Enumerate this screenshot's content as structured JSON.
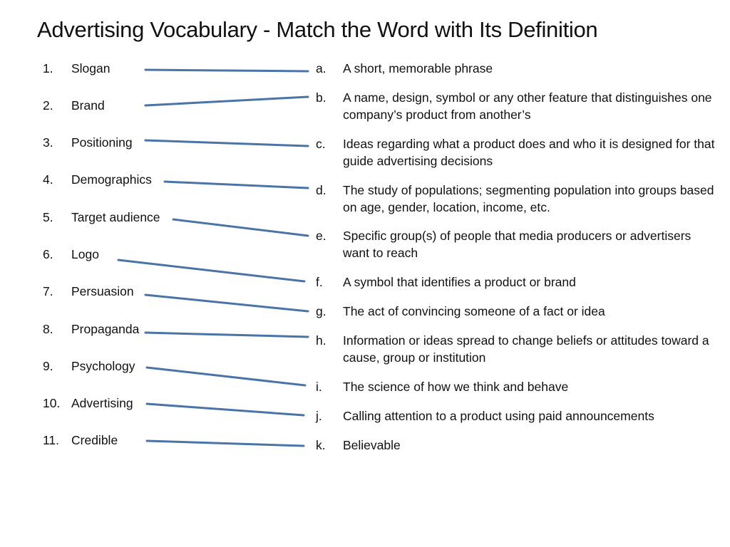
{
  "title": "Advertising Vocabulary - Match the Word with Its Definition",
  "line_color": "#4a74a8",
  "terms": [
    {
      "num": "1.",
      "word": "Slogan"
    },
    {
      "num": "2.",
      "word": "Brand"
    },
    {
      "num": "3.",
      "word": "Positioning"
    },
    {
      "num": "4.",
      "word": "Demographics"
    },
    {
      "num": "5.",
      "word": "Target audience"
    },
    {
      "num": "6.",
      "word": "Logo"
    },
    {
      "num": "7.",
      "word": "Persuasion"
    },
    {
      "num": "8.",
      "word": "Propaganda"
    },
    {
      "num": "9.",
      "word": "Psychology"
    },
    {
      "num": "10.",
      "word": "Advertising"
    },
    {
      "num": "11.",
      "word": "Credible"
    }
  ],
  "definitions": [
    {
      "letter": "a.",
      "text": "A short, memorable phrase"
    },
    {
      "letter": "b.",
      "text": "A name, design, symbol or any other feature that distinguishes one company’s product from another’s"
    },
    {
      "letter": "c.",
      "text": "Ideas regarding what a product does and who it is designed for that guide advertising decisions"
    },
    {
      "letter": "d.",
      "text": "The study of populations; segmenting population into groups based on age, gender, location, income, etc."
    },
    {
      "letter": "e.",
      "text": "Specific group(s) of people that media producers or advertisers want to reach"
    },
    {
      "letter": "f.",
      "text": "A symbol that identifies a product or brand"
    },
    {
      "letter": "g.",
      "text": "The act of convincing someone of a fact or idea"
    },
    {
      "letter": "h.",
      "text": "Information or ideas spread to change beliefs or attitudes toward a cause, group or institution"
    },
    {
      "letter": "i.",
      "text": "The science of how we think and behave"
    },
    {
      "letter": "j.",
      "text": "Calling attention to a product using paid announcements"
    },
    {
      "letter": "k.",
      "text": "Believable"
    }
  ],
  "matches": [
    {
      "term": "1.",
      "definition": "a."
    },
    {
      "term": "2.",
      "definition": "b."
    },
    {
      "term": "3.",
      "definition": "c."
    },
    {
      "term": "4.",
      "definition": "d."
    },
    {
      "term": "5.",
      "definition": "e."
    },
    {
      "term": "6.",
      "definition": "f."
    },
    {
      "term": "7.",
      "definition": "g."
    },
    {
      "term": "8.",
      "definition": "h."
    },
    {
      "term": "9.",
      "definition": "i."
    },
    {
      "term": "10.",
      "definition": "j."
    },
    {
      "term": "11.",
      "definition": "k."
    }
  ]
}
